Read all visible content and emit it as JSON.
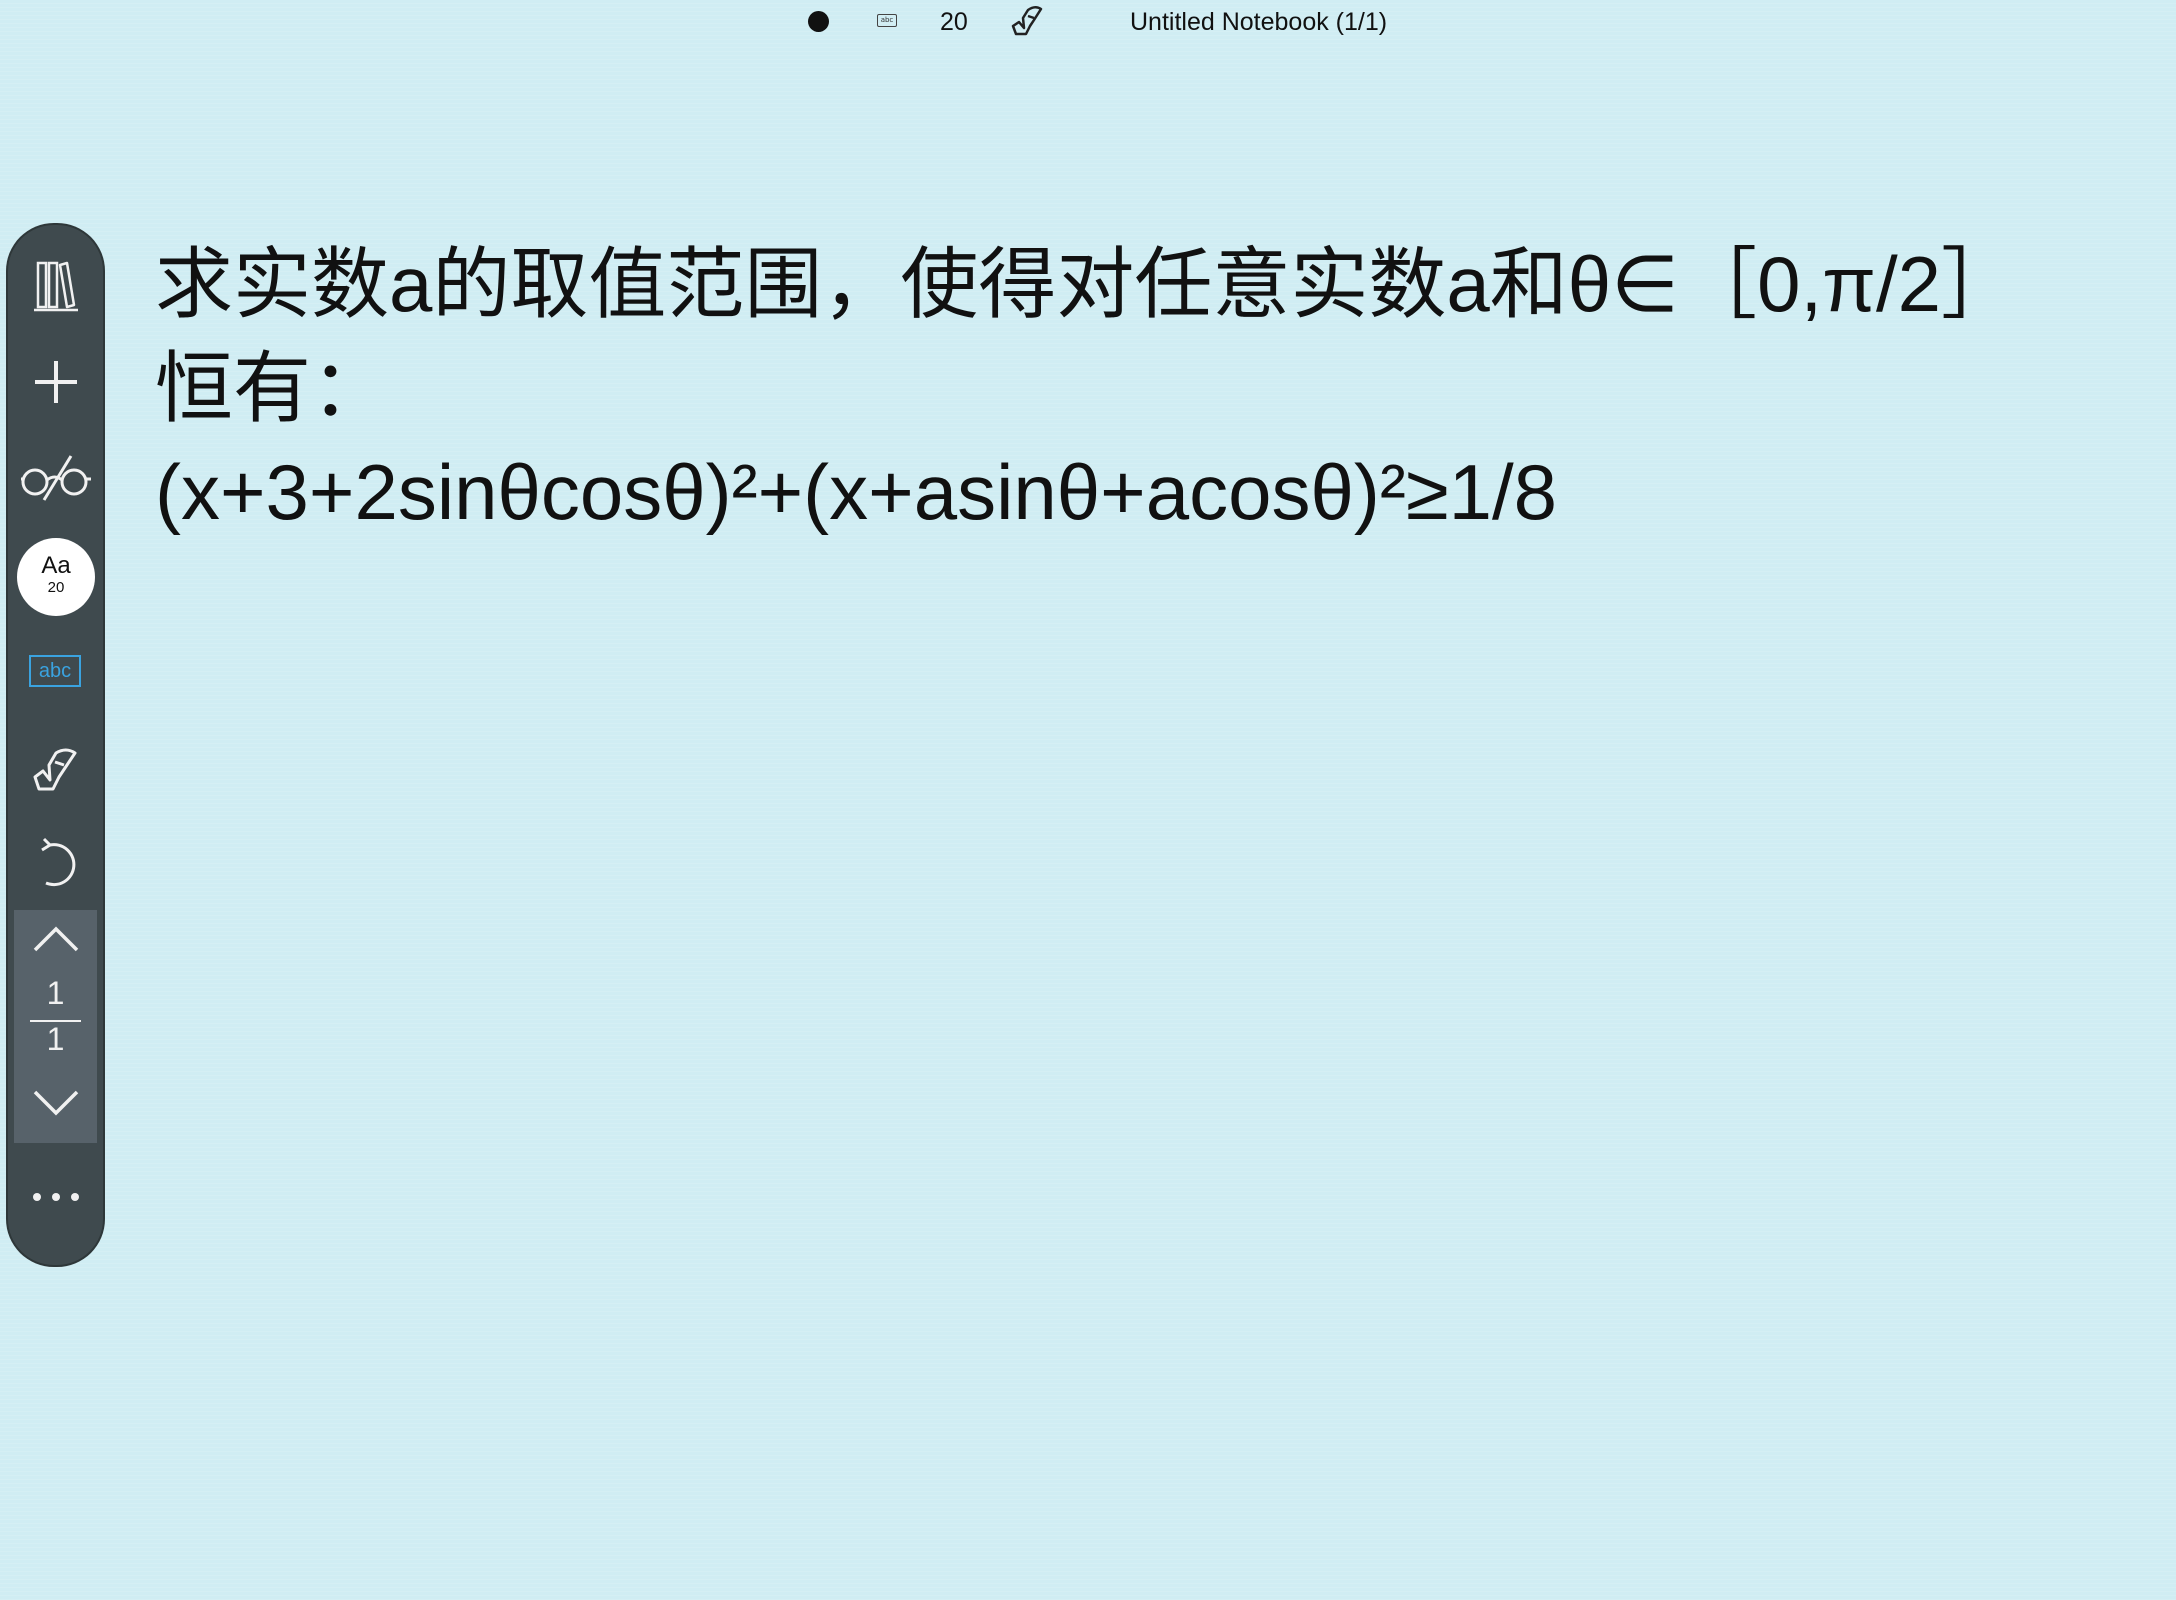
{
  "top_bar": {
    "font_size": "20",
    "keyboard_icon_text": "abc",
    "notebook_title": "Untitled Notebook (1/1)"
  },
  "sidebar": {
    "font_button_label": "Aa",
    "font_button_size": "20",
    "text_tool_label": "abc",
    "page_current": "1",
    "page_total": "1"
  },
  "note": {
    "lines": [
      "求实数a的取值范围，使得对任意实数a和θ∈［0,π/2］",
      "恒有：",
      "(x+3+2sinθcosθ)²+(x+asinθ+acosθ)²≥1/8"
    ]
  },
  "colors": {
    "background": "#d0edf3",
    "sidebar": "#3f4a4e",
    "page_panel": "#57626a",
    "text_tool_accent": "#3aa3e0",
    "ink": "#111111"
  },
  "icons": {
    "top_bar": [
      "pen-color-dot-icon",
      "keyboard-icon",
      "hand-icon"
    ],
    "sidebar": [
      "library-icon",
      "add-icon",
      "reading-glasses-icon",
      "font-icon",
      "text-tool-icon",
      "hand-icon",
      "undo-icon",
      "chevron-up-icon",
      "chevron-down-icon",
      "more-icon"
    ]
  }
}
